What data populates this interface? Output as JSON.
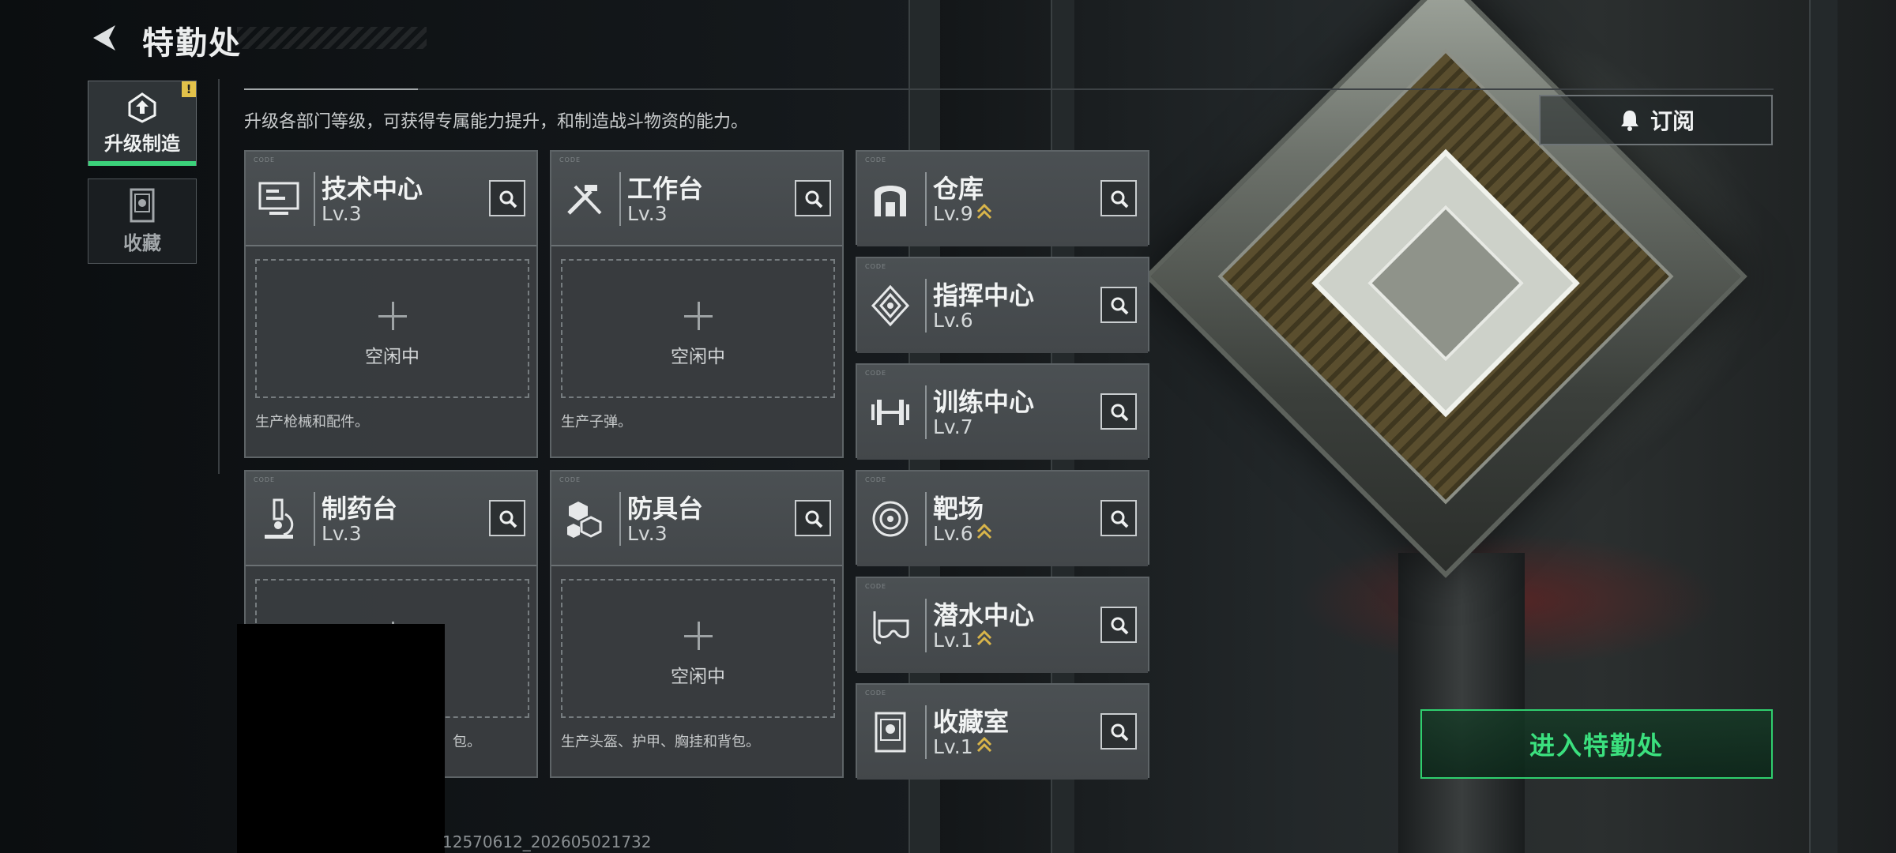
{
  "header": {
    "title": "特勤处"
  },
  "sidebar": {
    "items": [
      {
        "label": "升级制造",
        "badge": "!"
      },
      {
        "label": "收藏"
      }
    ]
  },
  "main": {
    "description": "升级各部门等级，可获得专属能力提升，和制造战斗物资的能力。",
    "production_cards": [
      {
        "name": "技术中心",
        "level": "Lv.3",
        "slot_label": "空闲中",
        "desc": "生产枪械和配件。"
      },
      {
        "name": "工作台",
        "level": "Lv.3",
        "slot_label": "空闲中",
        "desc": "生产子弹。"
      },
      {
        "name": "制药台",
        "level": "Lv.3",
        "slot_label": "",
        "desc": "包。"
      },
      {
        "name": "防具台",
        "level": "Lv.3",
        "slot_label": "空闲中",
        "desc": "生产头盔、护甲、胸挂和背包。"
      }
    ],
    "facilities": [
      {
        "name": "仓库",
        "level": "Lv.9",
        "upgradable": true
      },
      {
        "name": "指挥中心",
        "level": "Lv.6",
        "upgradable": false
      },
      {
        "name": "训练中心",
        "level": "Lv.7",
        "upgradable": false
      },
      {
        "name": "靶场",
        "level": "Lv.6",
        "upgradable": true
      },
      {
        "name": "潜水中心",
        "level": "Lv.1",
        "upgradable": true
      },
      {
        "name": "收藏室",
        "level": "Lv.1",
        "upgradable": true
      }
    ]
  },
  "actions": {
    "subscribe_label": "订阅",
    "enter_label": "进入特勤处"
  },
  "footer": {
    "build_id": "12570612_202605021732"
  },
  "colors": {
    "accent_green": "#3be07e",
    "upgrade_gold": "#d9b54a",
    "badge_yellow": "#e3c24a"
  },
  "icons": [
    "back-arrow-icon",
    "upgrade-craft-icon",
    "collection-icon",
    "monitor-icon",
    "tools-icon",
    "warehouse-icon",
    "command-icon",
    "dumbbell-icon",
    "microscope-icon",
    "blocks-icon",
    "target-icon",
    "diving-mask-icon",
    "display-case-icon",
    "search-icon",
    "bell-icon"
  ]
}
